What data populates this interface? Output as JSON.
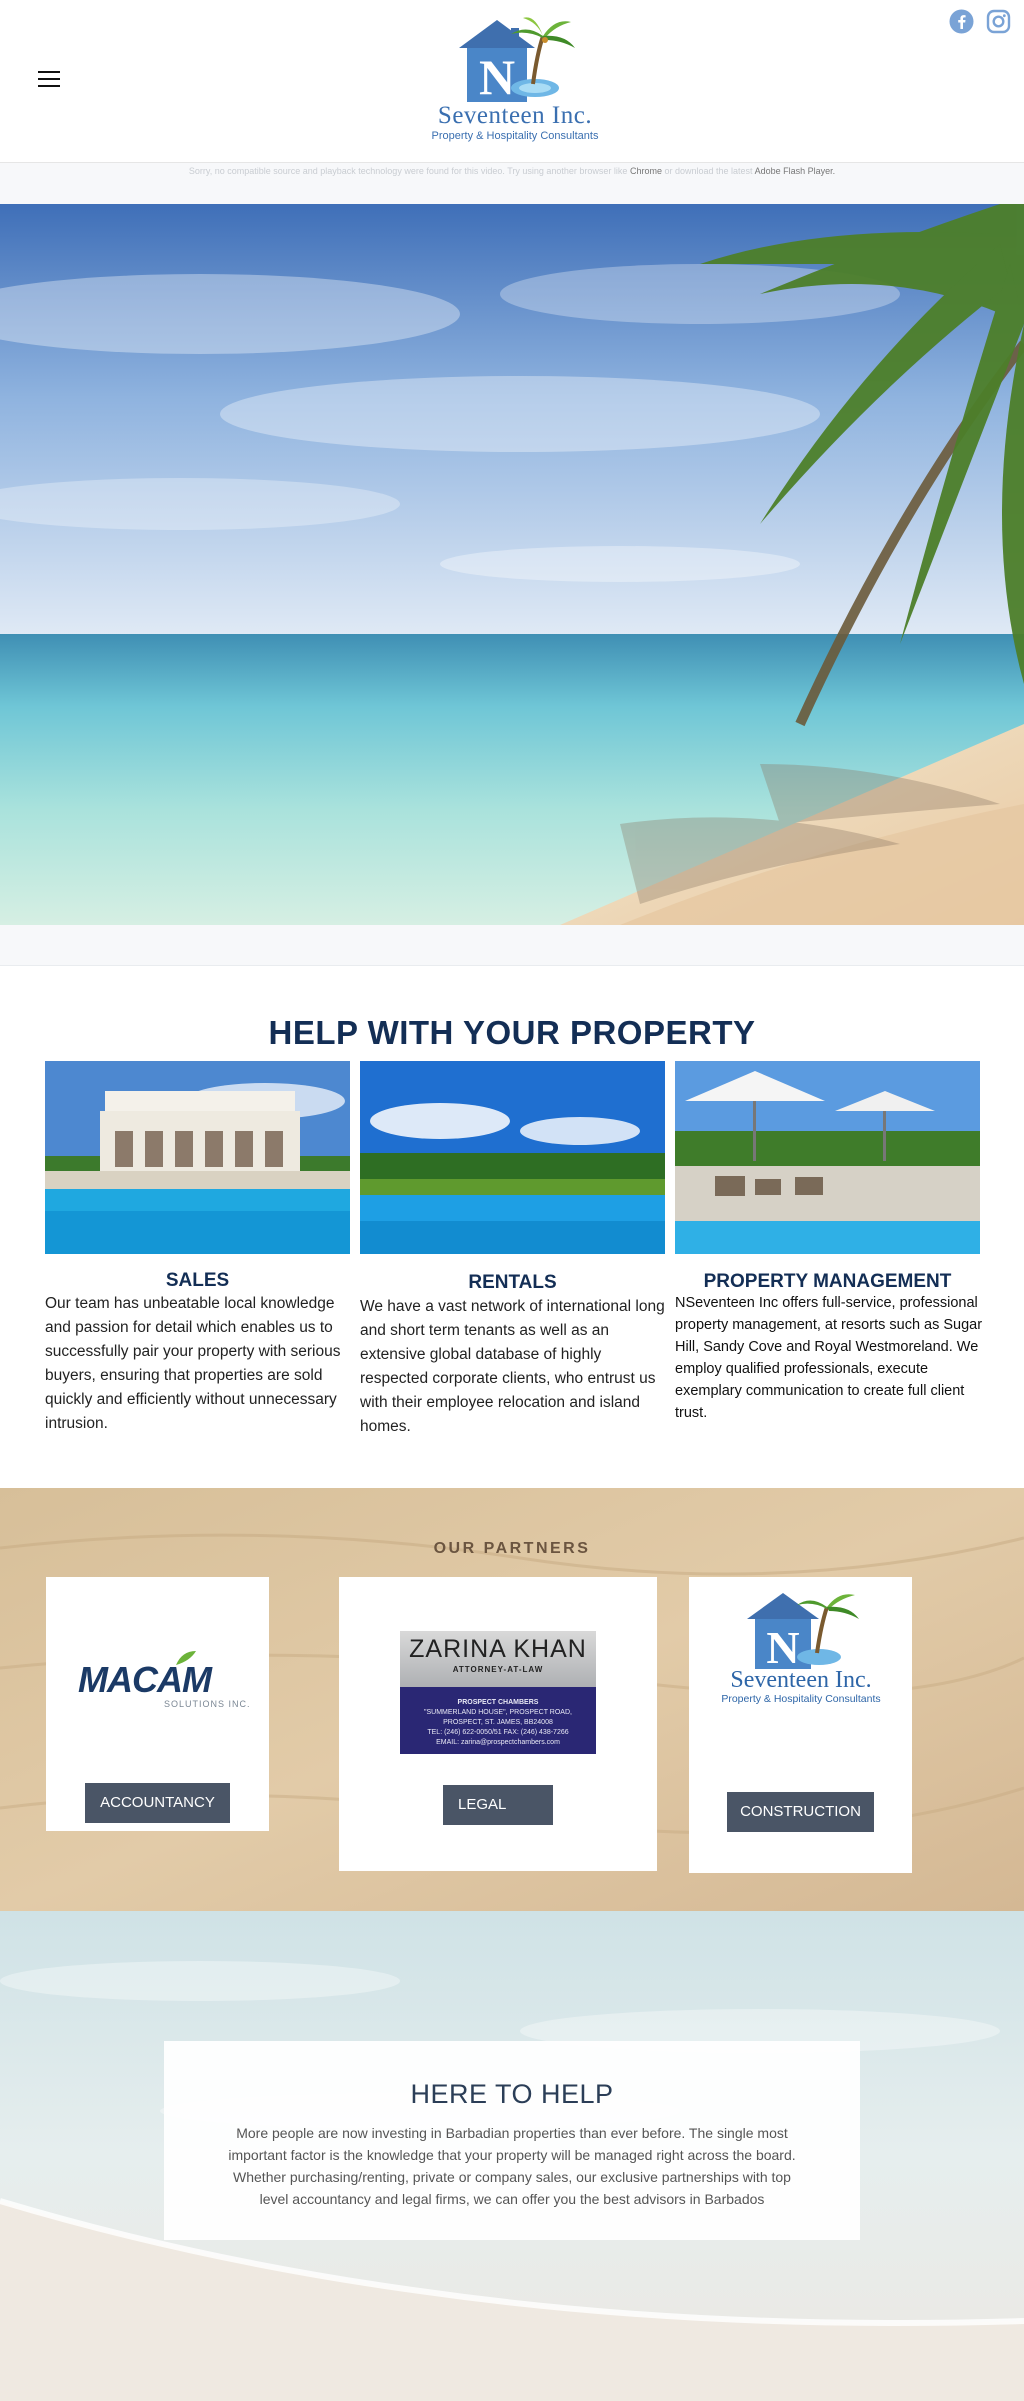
{
  "header": {
    "logo_name": "Seventeen Inc.",
    "logo_tagline": "Property & Hospitality Consultants",
    "logo_initial": "N",
    "social": [
      "facebook-icon",
      "instagram-icon"
    ]
  },
  "flash_notice": {
    "text_before": "Sorry, no compatible source and playback technology were found for this video. Try using another browser like",
    "link_chrome": "Chrome",
    "text_middle": "or download the latest",
    "link_flash": "Adobe Flash Player."
  },
  "help": {
    "title": "HELP WITH YOUR PROPERTY",
    "cards": [
      {
        "title": "SALES",
        "text": "Our team has unbeatable local knowledge and passion for detail which enables us to successfully pair your property with serious buyers, ensuring that properties are sold quickly and efficiently without unnecessary intrusion."
      },
      {
        "title": "RENTALS",
        "text": "We have a vast network of international long and short term tenants as well as an extensive global database of highly respected corporate clients, who entrust us with their employee relocation and island homes."
      },
      {
        "title": "PROPERTY MANAGEMENT",
        "text": "NSeventeen Inc offers full-service, professional property management, at  resorts such as Sugar Hill, Sandy Cove and Royal Westmoreland. We employ qualified professionals, execute exemplary communication to create full client trust."
      }
    ]
  },
  "partners": {
    "title": "OUR PARTNERS",
    "macam": {
      "word": "MACAM",
      "sub": "SOLUTIONS INC.",
      "button": "ACCOUNTANCY"
    },
    "zarina": {
      "name": "ZARINA KHAN",
      "sub": "ATTORNEY-AT-LAW",
      "lines": [
        "PROSPECT CHAMBERS",
        "\"SUMMERLAND HOUSE\", PROSPECT ROAD,",
        "PROSPECT, ST. JAMES, BB24008",
        "TEL: (246) 622-0050/51  FAX: (246) 438-7266",
        "EMAIL: zarina@prospectchambers.com"
      ],
      "button": "LEGAL"
    },
    "seventeen": {
      "name": "Seventeen Inc.",
      "tag": "Property & Hospitality Consultants",
      "button": "CONSTRUCTION"
    }
  },
  "here_to_help": {
    "title": "HERE TO HELP",
    "text": "More people are now investing in Barbadian properties than ever before. The single most important factor is the knowledge that your property will be managed right across the board. Whether purchasing/renting, private or company sales, our exclusive partnerships with top level accountancy and legal firms, we can offer you the best advisors in Barbados"
  }
}
